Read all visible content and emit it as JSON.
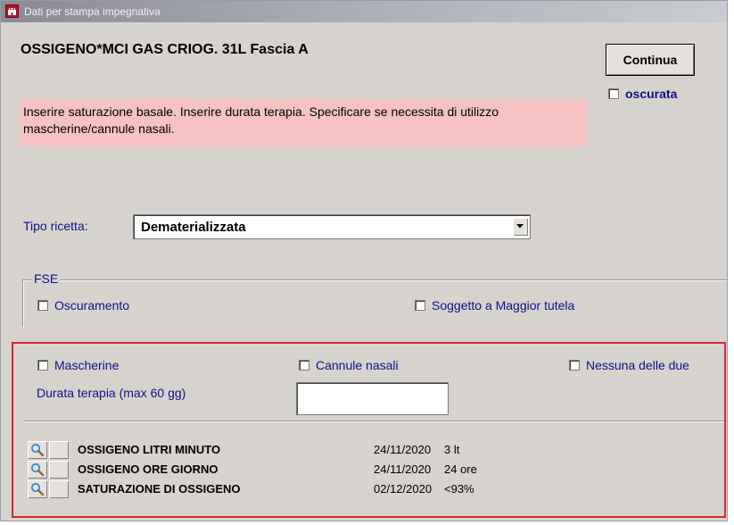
{
  "window": {
    "title": "Dati per stampa impegnativa"
  },
  "product": {
    "title": "OSSIGENO*MCI GAS CRIOG. 31L Fascia A"
  },
  "buttons": {
    "continua": "Continua"
  },
  "oscurata": {
    "label": "oscurata",
    "checked": false
  },
  "note": "Inserire saturazione basale.  Inserire durata terapia.  Specificare se necessita di utilizzo mascherine/cannule nasali.",
  "tipo_ricetta": {
    "label": "Tipo ricetta:",
    "value": "Dematerializzata"
  },
  "fse": {
    "legend": "FSE",
    "oscuramento": {
      "label": "Oscuramento",
      "checked": false
    },
    "soggetto": {
      "label": "Soggetto a Maggior tutela",
      "checked": false
    }
  },
  "options": {
    "mascherine": {
      "label": "Mascherine",
      "checked": false
    },
    "cannule": {
      "label": "Cannule nasali",
      "checked": false
    },
    "nessuna": {
      "label": "Nessuna delle due",
      "checked": false
    }
  },
  "durata": {
    "label": "Durata terapia (max 60 gg)",
    "value": ""
  },
  "rows": [
    {
      "name": "OSSIGENO LITRI MINUTO",
      "date": "24/11/2020",
      "value": "3 lt"
    },
    {
      "name": "OSSIGENO ORE GIORNO",
      "date": "24/11/2020",
      "value": "24 ore"
    },
    {
      "name": "SATURAZIONE DI OSSIGENO",
      "date": "02/12/2020",
      "value": "<93%"
    }
  ],
  "colors": {
    "window_bg": "#d6d3ce",
    "note_bg": "#f7c2c2",
    "highlight_frame": "#d7262e",
    "label_blue": "#10108a"
  }
}
